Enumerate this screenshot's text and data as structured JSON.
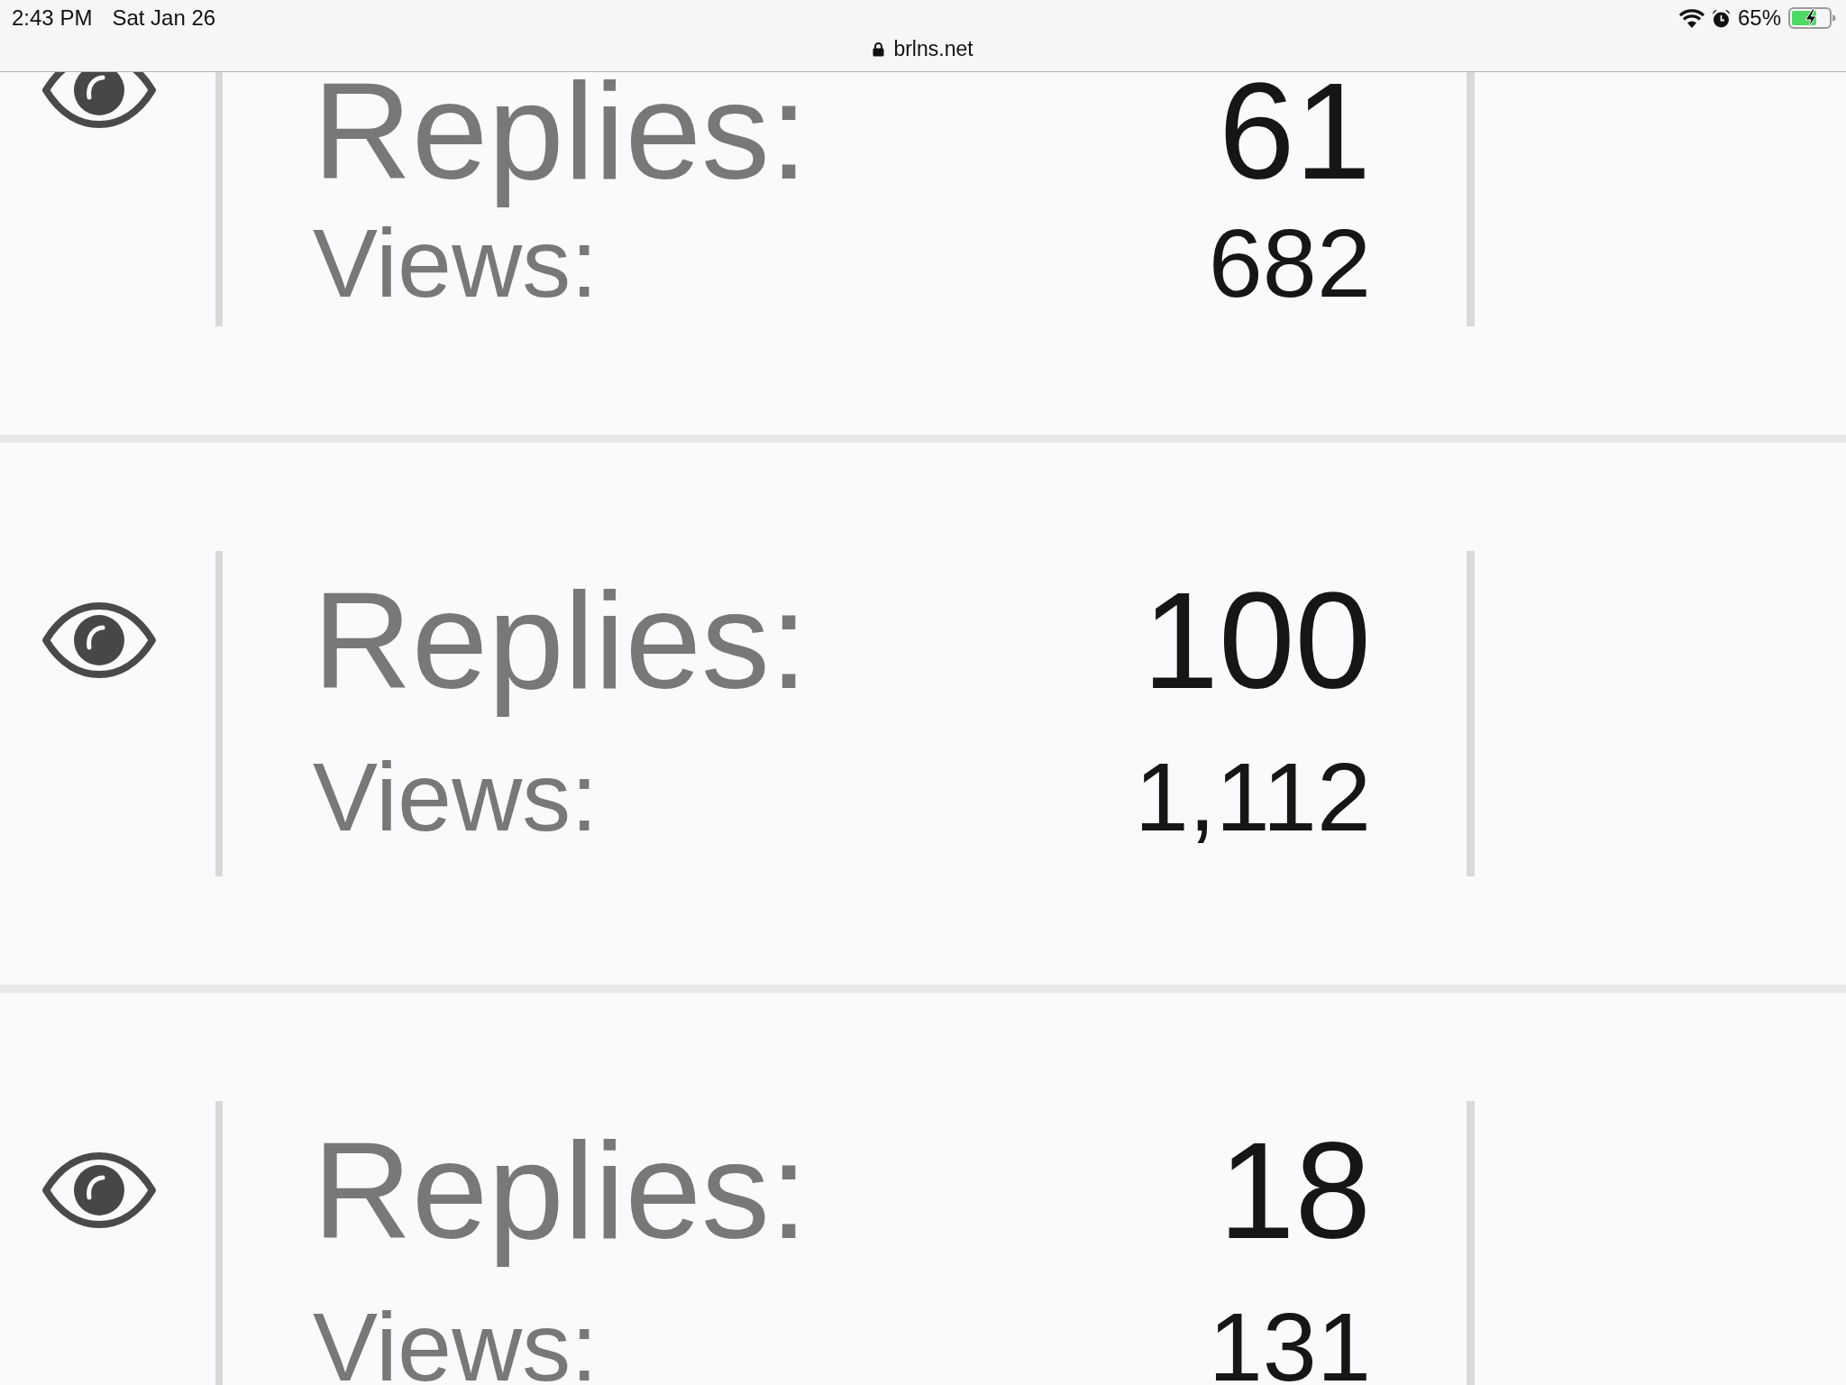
{
  "status_bar": {
    "time": "2:43 PM",
    "date": "Sat Jan 26",
    "url": "brlns.net",
    "battery_percent": "65%"
  },
  "topics": [
    {
      "replies_label": "Replies:",
      "replies": "61",
      "views_label": "Views:",
      "views": "682"
    },
    {
      "replies_label": "Replies:",
      "replies": "100",
      "views_label": "Views:",
      "views": "1,112"
    },
    {
      "replies_label": "Replies:",
      "replies": "18",
      "views_label": "Views:",
      "views": "131"
    }
  ]
}
